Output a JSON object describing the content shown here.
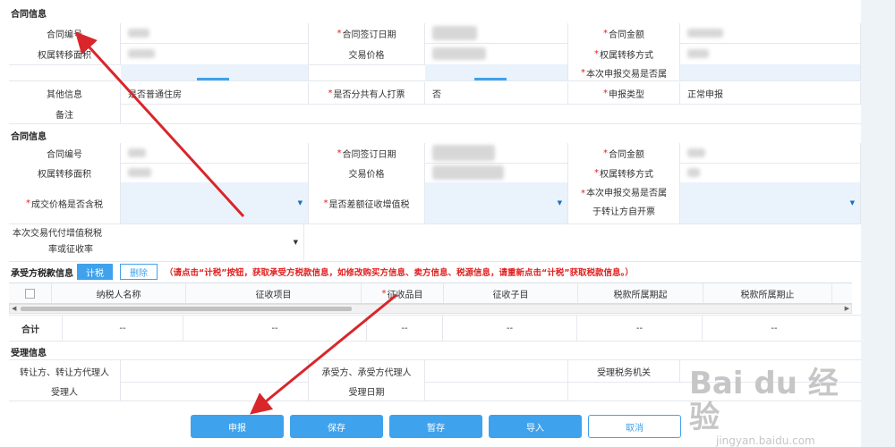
{
  "overlay": {
    "title": "合同信息",
    "row1": {
      "l1": "合同编号",
      "l2": "合同签订日期",
      "l3": "合同金额"
    },
    "row2": {
      "l1": "权属转移面积",
      "l2": "交易价格",
      "l3": "权属转移方式"
    },
    "row3": {
      "l3": "本次申报交易是否属"
    }
  },
  "top_rows": {
    "r1": {
      "l1": "其他信息",
      "v1": "是否普通住房",
      "l2": "是否分共有人打票",
      "v2": "否",
      "l3": "申报类型",
      "v3": "正常申报"
    },
    "r2": {
      "l1": "备注"
    }
  },
  "contract": {
    "title": "合同信息",
    "r1": {
      "l1": "合同编号",
      "l2": "合同签订日期",
      "l3": "合同金额"
    },
    "r2": {
      "l1": "权属转移面积",
      "l2": "交易价格",
      "l3": "权属转移方式"
    },
    "r3": {
      "l1": "成交价格是否含税",
      "l2": "是否差额征收增值税",
      "l3a": "本次申报交易是否属",
      "l3b": "于转让方自开票"
    },
    "r4": {
      "l1a": "本次交易代付增值税税",
      "l1b": "率或征收率"
    }
  },
  "tax": {
    "title": "承受方税款信息",
    "calc_btn": "计税",
    "delete_btn": "删除",
    "notice": "（请点击“计税”按钮，获取承受方税款信息，如修改购买方信息、卖方信息、税源信息，请重新点击“计税”获取税款信息。）",
    "columns": [
      "纳税人名称",
      "征收项目",
      "征收品目",
      "征收子目",
      "税款所属期起",
      "税款所属期止"
    ],
    "required_col": "征收品目",
    "total_label": "合计",
    "dash": "--"
  },
  "acceptance": {
    "title": "受理信息",
    "l1": "转让方、转让方代理人",
    "l2": "承受方、承受方代理人",
    "l3": "受理税务机关",
    "l4": "受理人",
    "l5": "受理日期"
  },
  "buttons": {
    "submit": "申报",
    "save": "保存",
    "hold": "暂存",
    "import": "导入",
    "cancel": "取消"
  },
  "watermark": {
    "brand": "Bai du 经验",
    "url": "jingyan.baidu.com"
  },
  "colors": {
    "accent": "#3fa2ec",
    "required": "#e02020",
    "arrow": "#d9262b"
  }
}
